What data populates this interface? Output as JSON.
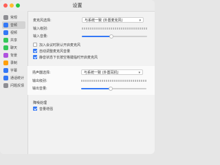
{
  "window": {
    "title": "设置",
    "traffic_lights": {
      "close": "#ff5f57",
      "minimize": "#febc2e",
      "zoom": "#28c840"
    }
  },
  "sidebar": {
    "items": [
      {
        "label": "常规",
        "icon": "general-icon",
        "color": "#8e8e93",
        "active": false
      },
      {
        "label": "音频",
        "icon": "microphone-icon",
        "color": "#3478f6",
        "active": true
      },
      {
        "label": "视频",
        "icon": "video-icon",
        "color": "#3478f6",
        "active": false
      },
      {
        "label": "共享",
        "icon": "share-icon",
        "color": "#34c759",
        "active": false
      },
      {
        "label": "聊天",
        "icon": "chat-icon",
        "color": "#34c759",
        "active": false
      },
      {
        "label": "背景",
        "icon": "background-icon",
        "color": "#af52de",
        "active": false
      },
      {
        "label": "录制",
        "icon": "record-icon",
        "color": "#ff9f0a",
        "active": false
      },
      {
        "label": "字幕",
        "icon": "caption-icon",
        "color": "#3478f6",
        "active": false
      },
      {
        "label": "通话统计",
        "icon": "stats-icon",
        "color": "#3478f6",
        "active": false
      },
      {
        "label": "问题反馈",
        "icon": "feedback-icon",
        "color": "#8e8e93",
        "active": false
      }
    ]
  },
  "microphone": {
    "label": "麦克风选择:",
    "selected": "与系统一致 (外置麦克风)",
    "level_label": "输入级别:",
    "volume_label": "输入音量:",
    "volume": 0.45
  },
  "checkboxes": [
    {
      "label": "加入会议时默认开启麦克风",
      "checked": false
    },
    {
      "label": "自动调整麦克风音量",
      "checked": true
    },
    {
      "label": "静音状态下长按空格键临时开启麦克风",
      "checked": true
    }
  ],
  "speaker": {
    "label": "扬声器选择:",
    "selected": "与系统一致 (外置耳机)",
    "level_label": "输出级别:",
    "volume_label": "输出音量:",
    "volume": 0.45
  },
  "noise": {
    "heading": "降噪处理",
    "checkbox_label": "音量增强",
    "checked": true
  }
}
